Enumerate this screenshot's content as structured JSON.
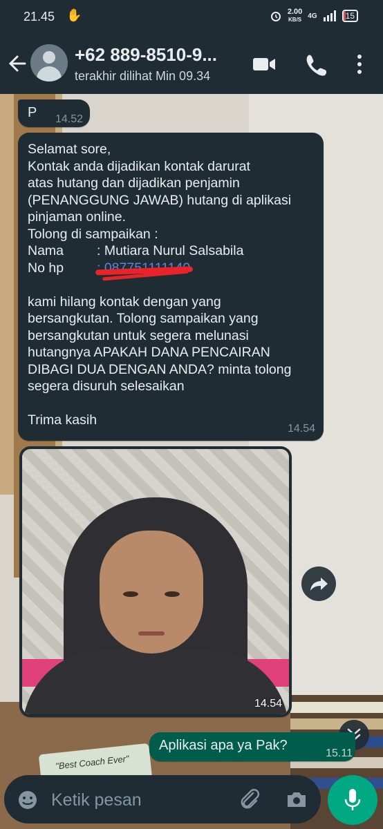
{
  "status_bar": {
    "time": "21.45",
    "net_speed_value": "2.00",
    "net_speed_unit": "KB/S",
    "network": "4G",
    "battery": "15",
    "battery_fraction": 0.15,
    "battery_color": "#e24d5b"
  },
  "header": {
    "contact_name": "+62 889-8510-9...",
    "last_seen": "terakhir dilihat Min 09.34",
    "icons": [
      "back-arrow-icon",
      "avatar",
      "video-call-icon",
      "phone-call-icon",
      "more-vert-icon"
    ]
  },
  "messages": [
    {
      "direction": "incoming",
      "text": "P",
      "time": "14.52"
    },
    {
      "direction": "incoming",
      "lines_before": "Selamat sore,\nKontak anda dijadikan kontak darurat\natas hutang dan dijadikan penjamin\n(PENANGGUNG JAWAB) hutang di aplikasi\npinjaman online.\nTolong di sampaikan :",
      "name_label": "Nama",
      "name_value": ": Mutiara Nurul Salsabila",
      "phone_label": "No hp",
      "phone_value": ": 087751111140",
      "lines_after": "kami hilang kontak dengan yang\nbersangkutan. Tolong sampaikan yang\nbersangkutan untuk segera melunasi\nhutangnya APAKAH DANA PENCAIRAN\nDIBAGI DUA DENGAN ANDA? minta tolong\nsegera disuruh selesaikan\n\nTrima kasih",
      "time": "14.54"
    },
    {
      "direction": "incoming",
      "type": "image",
      "time": "14.54"
    },
    {
      "direction": "outgoing",
      "text": "Aplikasi apa ya Pak?",
      "time": "15.11"
    }
  ],
  "background_text": "\"Best Coach Ever\"",
  "input": {
    "placeholder": "Ketik pesan",
    "icons": [
      "emoji-icon",
      "attach-icon",
      "camera-icon",
      "mic-icon"
    ]
  },
  "colors": {
    "header_bg": "#1f2c34",
    "incoming_bubble": "#1f2c34",
    "outgoing_bubble": "#005c4b",
    "accent": "#00a884",
    "redaction": "#e8232a"
  }
}
